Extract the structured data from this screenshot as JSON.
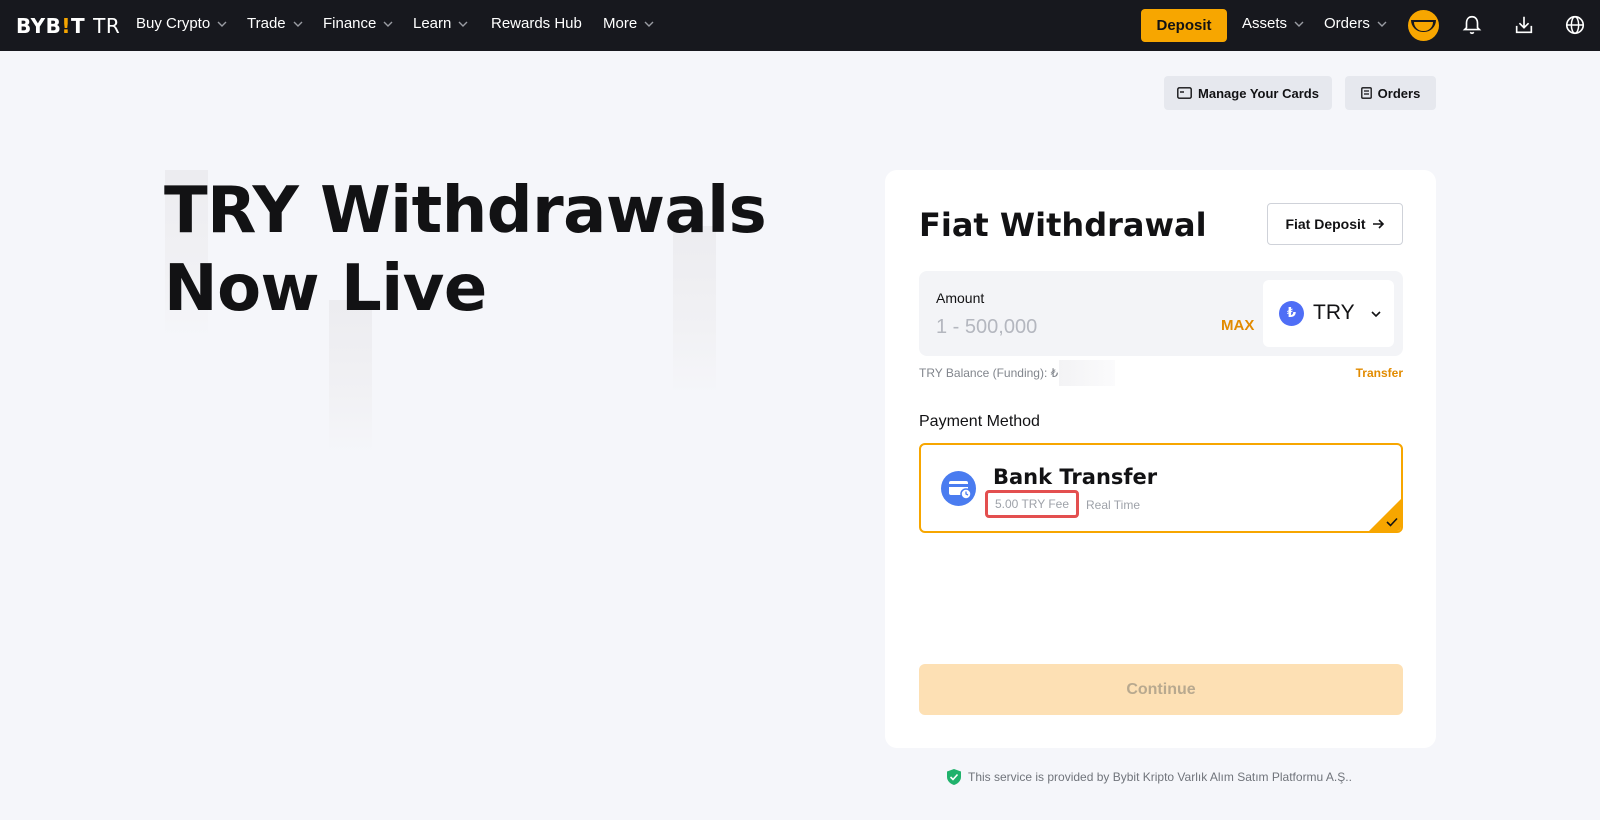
{
  "nav": {
    "logo_main": "BYB",
    "logo_bang": "!",
    "logo_end": "T",
    "logo_suffix": "TR",
    "items": [
      {
        "label": "Buy Crypto"
      },
      {
        "label": "Trade"
      },
      {
        "label": "Finance"
      },
      {
        "label": "Learn"
      },
      {
        "label": "Rewards Hub"
      },
      {
        "label": "More"
      }
    ],
    "deposit_label": "Deposit",
    "assets_label": "Assets",
    "orders_label": "Orders",
    "icons": [
      "avatar",
      "bell-icon",
      "download-icon",
      "globe-icon"
    ]
  },
  "top_actions": {
    "manage_cards_label": "Manage Your Cards",
    "orders_label": "Orders"
  },
  "hero": {
    "line1": "TRY Withdrawals",
    "line2": "Now Live"
  },
  "withdrawal": {
    "title": "Fiat Withdrawal",
    "fiat_deposit_label": "Fiat Deposit",
    "amount_label": "Amount",
    "amount_placeholder": "1 - 500,000",
    "amount_value": "",
    "max_label": "MAX",
    "currency_symbol": "₺",
    "currency_code": "TRY",
    "balance_label": "TRY Balance (Funding): ₺",
    "transfer_label": "Transfer",
    "payment_method_label": "Payment Method",
    "payment_method": {
      "name": "Bank Transfer",
      "fee": "5.00 TRY Fee",
      "speed": "Real Time",
      "selected": true
    },
    "continue_label": "Continue"
  },
  "footer": {
    "note": "This service is provided by Bybit Kripto Varlık Alım Satım Platformu A.Ş.."
  },
  "colors": {
    "nav_bg": "#17181e",
    "accent": "#f7a600",
    "accent_text": "#e28b00",
    "page_bg": "#f5f6fa",
    "continue_disabled": "#fde0b4",
    "highlight_red": "#e34f4f",
    "coin_blue": "#4f6ef6",
    "shield_green": "#20b26c"
  }
}
